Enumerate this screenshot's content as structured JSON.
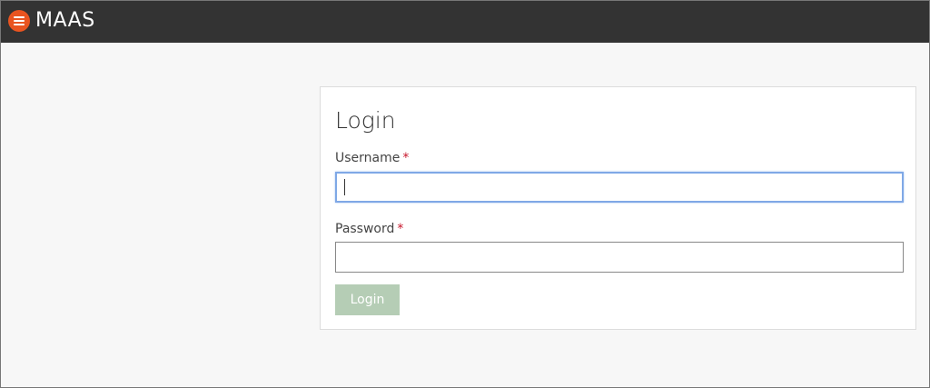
{
  "app": {
    "brand_name": "MAAS",
    "logo_icon": "maas-logo-icon",
    "brand_color": "#e95420",
    "topbar_color": "#333333"
  },
  "login_form": {
    "title": "Login",
    "username": {
      "label": "Username",
      "required_marker": "*",
      "value": "",
      "placeholder": ""
    },
    "password": {
      "label": "Password",
      "required_marker": "*",
      "value": "",
      "placeholder": ""
    },
    "submit_label": "Login",
    "submit_color": "#b5cdb5"
  }
}
